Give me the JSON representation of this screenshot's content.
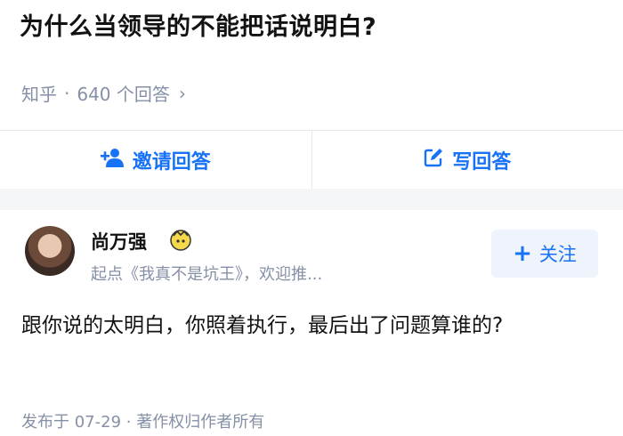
{
  "question": {
    "title": "为什么当领导的不能把话说明白?"
  },
  "meta": {
    "source": "知乎",
    "separator": "·",
    "answer_count": "640 个回答",
    "chevron": "›"
  },
  "actions": {
    "invite": {
      "label": "邀请回答",
      "icon": "add-person-icon"
    },
    "write": {
      "label": "写回答",
      "icon": "edit-icon"
    }
  },
  "answer": {
    "author_name": "尚万强",
    "author_desc": "起点《我真不是坑王》，欢迎推...",
    "badge_icon": "creator-badge-icon",
    "follow": {
      "plus": "+",
      "label": "关注"
    },
    "text": "跟你说的太明白，你照着执行，最后出了问题算谁的?",
    "footer": "发布于 07-29 · 著作权归作者所有"
  },
  "colors": {
    "accent": "#1772f6",
    "muted": "#8590a6",
    "follow_bg": "#eef3fc",
    "band": "#f4f5f7"
  }
}
